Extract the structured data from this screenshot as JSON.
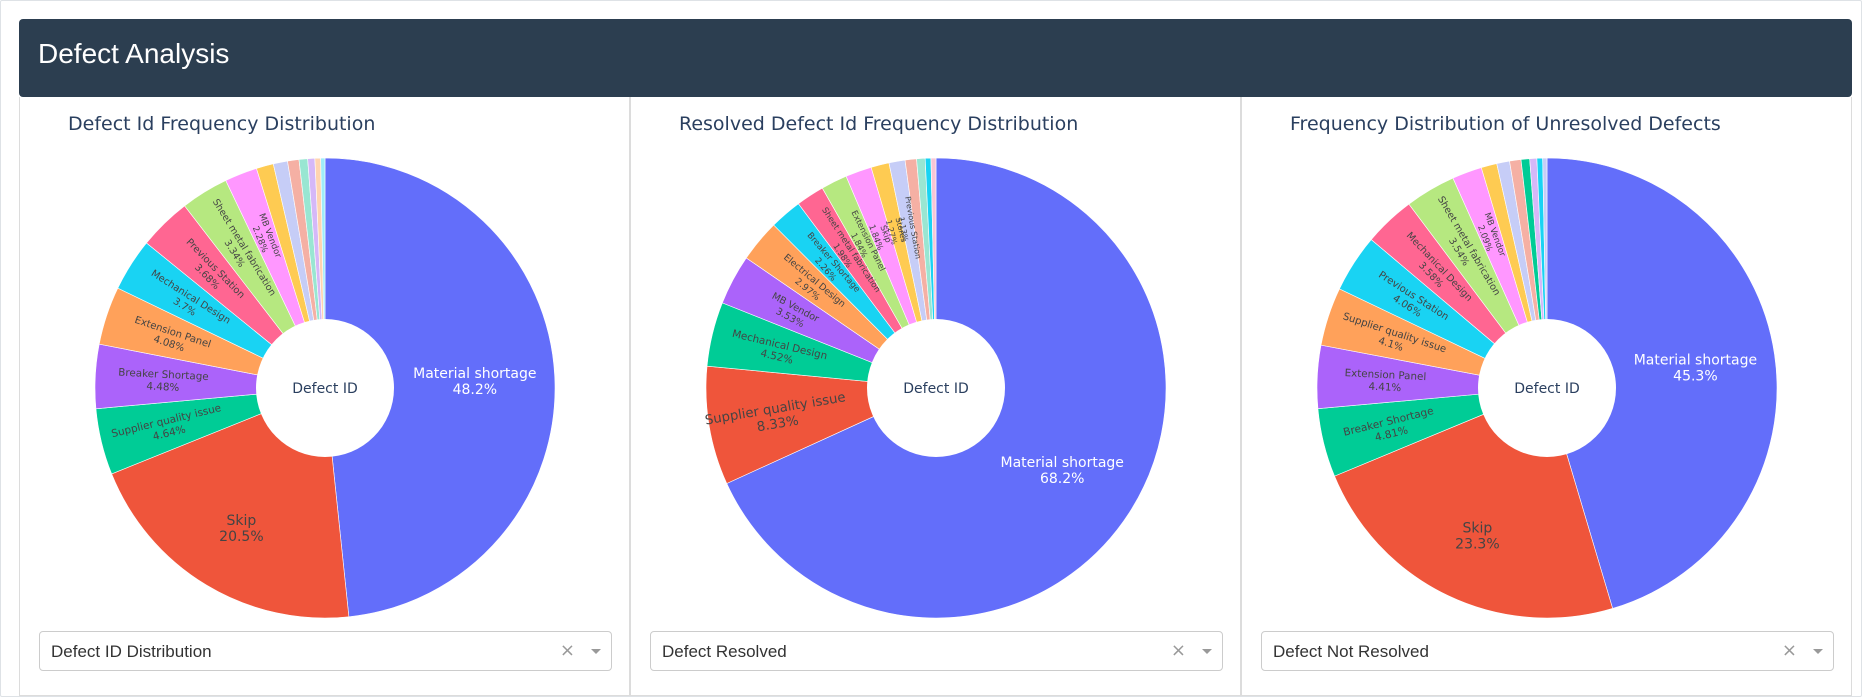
{
  "header": {
    "title": "Defect Analysis"
  },
  "colors": {
    "header_bg": "#2c3e50",
    "palette": [
      "#636efa",
      "#ef553b",
      "#00cc96",
      "#ab63fa",
      "#ffa15a",
      "#19d3f3",
      "#ff6692",
      "#b6e880",
      "#ff97ff",
      "#fecb52"
    ]
  },
  "panels": [
    {
      "dropdown": {
        "value": "Defect ID Distribution",
        "clear_icon": "×",
        "arrow_icon": "chevron-down-icon"
      }
    },
    {
      "dropdown": {
        "value": "Defect Resolved",
        "clear_icon": "×",
        "arrow_icon": "chevron-down-icon"
      }
    },
    {
      "dropdown": {
        "value": "Defect Not Resolved",
        "clear_icon": "×",
        "arrow_icon": "chevron-down-icon"
      }
    }
  ],
  "chart_data": [
    {
      "type": "pie",
      "donut": true,
      "title": "Defect Id Frequency Distribution",
      "center_label": "Defect ID",
      "slices": [
        {
          "label": "Material shortage",
          "value": 48.2,
          "pct": "48.2%",
          "color": "#636efa",
          "inside": true
        },
        {
          "label": "Skip",
          "value": 20.5,
          "pct": "20.5%",
          "color": "#ef553b"
        },
        {
          "label": "Supplier quality issue",
          "value": 4.64,
          "pct": "4.64%",
          "color": "#00cc96"
        },
        {
          "label": "Breaker Shortage",
          "value": 4.48,
          "pct": "4.48%",
          "color": "#ab63fa"
        },
        {
          "label": "Extension Panel",
          "value": 4.08,
          "pct": "4.08%",
          "color": "#ffa15a"
        },
        {
          "label": "Mechanical Design",
          "value": 3.7,
          "pct": "3.7%",
          "color": "#19d3f3"
        },
        {
          "label": "Previous Station",
          "value": 3.68,
          "pct": "3.68%",
          "color": "#ff6692"
        },
        {
          "label": "Sheet metal fabrication",
          "value": 3.34,
          "pct": "3.34%",
          "color": "#b6e880"
        },
        {
          "label": "MB Vendor",
          "value": 2.28,
          "pct": "2.28%",
          "color": "#ff97ff"
        },
        {
          "label": "",
          "value": 1.2,
          "pct": "",
          "color": "#fecb52"
        },
        {
          "label": "",
          "value": 1.0,
          "pct": "",
          "color": "#c6cdf7"
        },
        {
          "label": "",
          "value": 0.8,
          "pct": "",
          "color": "#f5b0a4"
        },
        {
          "label": "",
          "value": 0.6,
          "pct": "",
          "color": "#99e6d2"
        },
        {
          "label": "",
          "value": 0.5,
          "pct": "",
          "color": "#d5b8f8"
        },
        {
          "label": "",
          "value": 0.4,
          "pct": "",
          "color": "#ffd4b0"
        },
        {
          "label": "",
          "value": 0.3,
          "pct": "",
          "color": "#9fecf9"
        }
      ]
    },
    {
      "type": "pie",
      "donut": true,
      "title": "Resolved Defect Id Frequency Distribution",
      "center_label": "Defect ID",
      "slices": [
        {
          "label": "Material shortage",
          "value": 68.2,
          "pct": "68.2%",
          "color": "#636efa",
          "inside": true
        },
        {
          "label": "Supplier quality issue",
          "value": 8.33,
          "pct": "8.33%",
          "color": "#ef553b"
        },
        {
          "label": "Mechanical Design",
          "value": 4.52,
          "pct": "4.52%",
          "color": "#00cc96"
        },
        {
          "label": "MB Vendor",
          "value": 3.53,
          "pct": "3.53%",
          "color": "#ab63fa"
        },
        {
          "label": "Electrical Design",
          "value": 2.97,
          "pct": "2.97%",
          "color": "#ffa15a"
        },
        {
          "label": "Breaker Shortage",
          "value": 2.26,
          "pct": "2.26%",
          "color": "#19d3f3"
        },
        {
          "label": "Sheet metal fabrication",
          "value": 1.98,
          "pct": "1.98%",
          "color": "#ff6692"
        },
        {
          "label": "Extension Panel",
          "value": 1.84,
          "pct": "1.84%",
          "color": "#b6e880"
        },
        {
          "label": "Skip",
          "value": 1.84,
          "pct": "1.84%",
          "color": "#ff97ff"
        },
        {
          "label": "Stores",
          "value": 1.27,
          "pct": "1.27%",
          "color": "#fecb52"
        },
        {
          "label": "Previous Station",
          "value": 1.13,
          "pct": "1.13%",
          "color": "#c6cdf7"
        },
        {
          "label": "",
          "value": 0.8,
          "pct": "",
          "color": "#f5b0a4"
        },
        {
          "label": "",
          "value": 0.6,
          "pct": "",
          "color": "#99e6d2"
        },
        {
          "label": "",
          "value": 0.4,
          "pct": "",
          "color": "#19d3f3"
        },
        {
          "label": "",
          "value": 0.35,
          "pct": "",
          "color": "#f8c6d6"
        }
      ]
    },
    {
      "type": "pie",
      "donut": true,
      "title": "Frequency Distribution of Unresolved Defects",
      "center_label": "Defect ID",
      "slices": [
        {
          "label": "Material shortage",
          "value": 45.3,
          "pct": "45.3%",
          "color": "#636efa",
          "inside": true
        },
        {
          "label": "Skip",
          "value": 23.3,
          "pct": "23.3%",
          "color": "#ef553b"
        },
        {
          "label": "Breaker Shortage",
          "value": 4.81,
          "pct": "4.81%",
          "color": "#00cc96"
        },
        {
          "label": "Extension Panel",
          "value": 4.41,
          "pct": "4.41%",
          "color": "#ab63fa"
        },
        {
          "label": "Supplier quality issue",
          "value": 4.1,
          "pct": "4.1%",
          "color": "#ffa15a"
        },
        {
          "label": "Previous Station",
          "value": 4.06,
          "pct": "4.06%",
          "color": "#19d3f3"
        },
        {
          "label": "Mechanical Design",
          "value": 3.58,
          "pct": "3.58%",
          "color": "#ff6692"
        },
        {
          "label": "Sheet metal fabrication",
          "value": 3.54,
          "pct": "3.54%",
          "color": "#b6e880"
        },
        {
          "label": "MB Vendor",
          "value": 2.09,
          "pct": "2.09%",
          "color": "#ff97ff"
        },
        {
          "label": "",
          "value": 1.1,
          "pct": "",
          "color": "#fecb52"
        },
        {
          "label": "",
          "value": 0.9,
          "pct": "",
          "color": "#c6cdf7"
        },
        {
          "label": "",
          "value": 0.8,
          "pct": "",
          "color": "#f5b0a4"
        },
        {
          "label": "",
          "value": 0.6,
          "pct": "",
          "color": "#00cc96"
        },
        {
          "label": "",
          "value": 0.5,
          "pct": "",
          "color": "#d5b8f8"
        },
        {
          "label": "",
          "value": 0.4,
          "pct": "",
          "color": "#19d3f3"
        },
        {
          "label": "",
          "value": 0.3,
          "pct": "",
          "color": "#c6cdf7"
        }
      ]
    }
  ]
}
